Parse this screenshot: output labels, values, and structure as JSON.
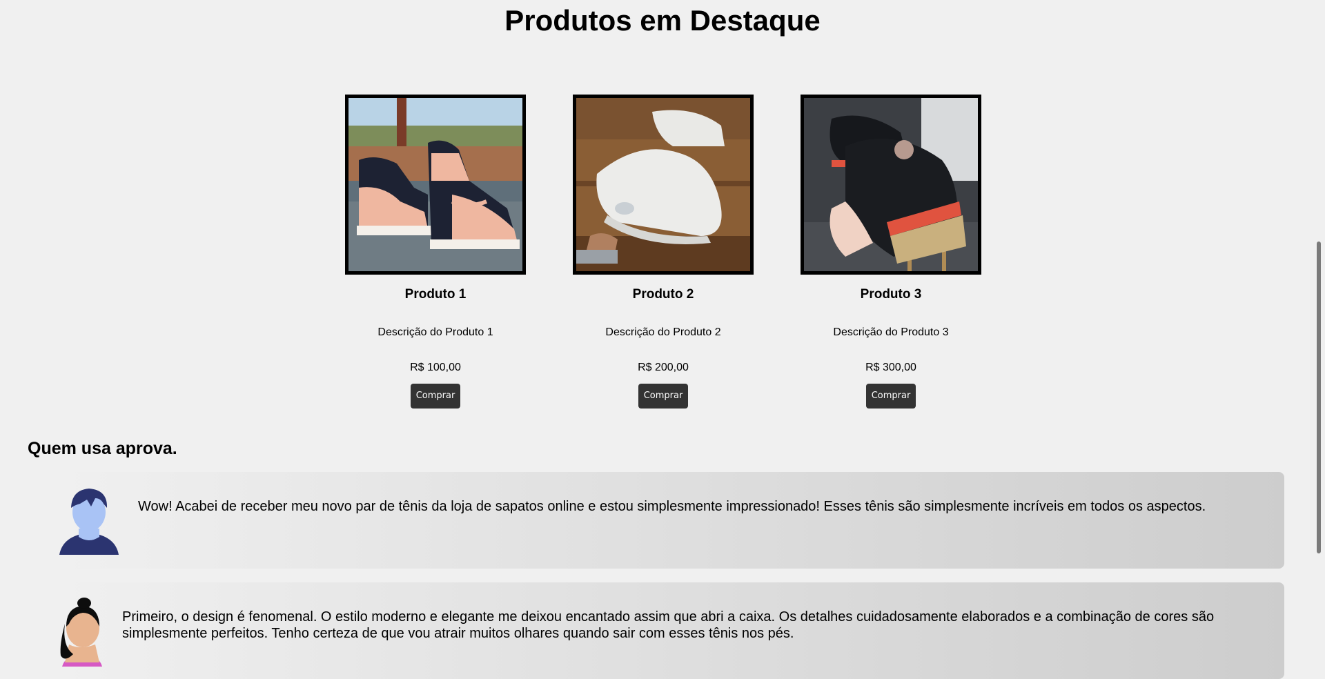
{
  "page": {
    "title": "Produtos em Destaque"
  },
  "products": [
    {
      "name": "Produto 1",
      "description": "Descrição do Produto 1",
      "price": "R$ 100,00",
      "button": "Comprar",
      "image": "pink-black-high-top-sneakers-image"
    },
    {
      "name": "Produto 2",
      "description": "Descrição do Produto 2",
      "price": "R$ 200,00",
      "button": "Comprar",
      "image": "white-sneaker-image"
    },
    {
      "name": "Produto 3",
      "description": "Descrição do Produto 3",
      "price": "R$ 300,00",
      "button": "Comprar",
      "image": "black-chunky-sneaker-image"
    }
  ],
  "testimonials": {
    "title": "Quem usa aprova.",
    "items": [
      {
        "avatar": "male-avatar-icon",
        "text": "Wow! Acabei de receber meu novo par de tênis da loja de sapatos online e estou simplesmente impressionado! Esses tênis são simplesmente incríveis em todos os aspectos."
      },
      {
        "avatar": "female-avatar-icon",
        "text": "Primeiro, o design é fenomenal. O estilo moderno e elegante me deixou encantado assim que abri a caixa. Os detalhes cuidadosamente elaborados e a combinação de cores são simplesmente perfeitos. Tenho certeza de que vou atrair muitos olhares quando sair com esses tênis nos pés."
      }
    ]
  },
  "colors": {
    "background": "#f0f0f0",
    "button": "#333333",
    "button_text": "#ffffff"
  }
}
